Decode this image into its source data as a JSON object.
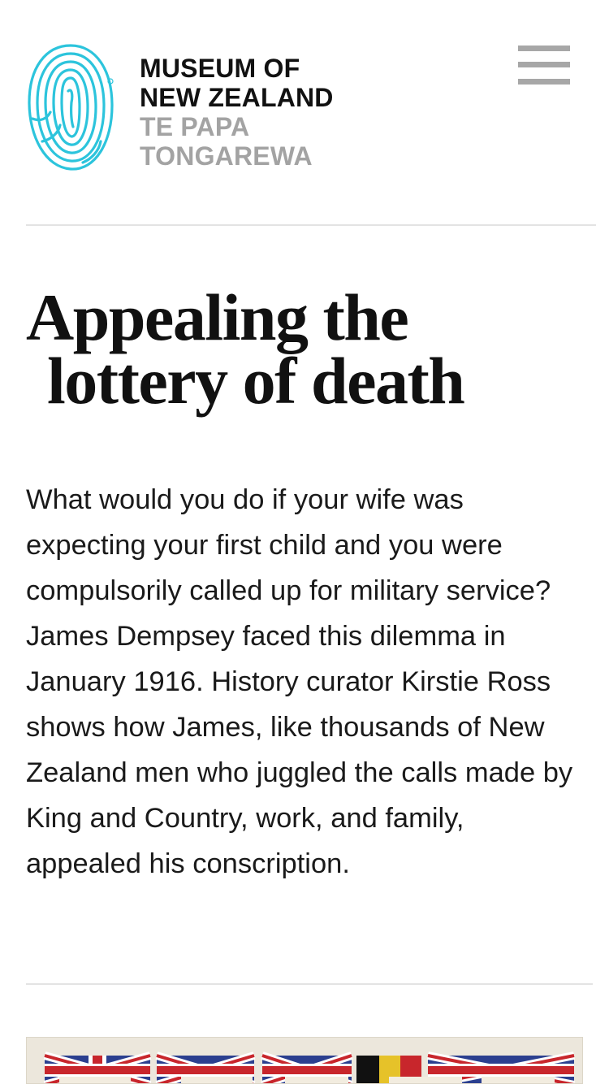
{
  "header": {
    "logo": {
      "icon": "fingerprint-logo-icon",
      "line1": "MUSEUM OF",
      "line2": "NEW ZEALAND",
      "line3": "TE PAPA",
      "line4": "TONGAREWA"
    },
    "menu_icon": "hamburger-menu-icon"
  },
  "article": {
    "title_line1": "Appealing the",
    "title_line2": "lottery of death",
    "intro": "What would you do if your wife was expecting your first child and you were compulsorily called up for military service? James Dempsey faced this dilemma in January 1916. History curator Kirstie Ross shows how James, like thousands of New Zealand men who juggled the calls made by King and Country, work, and family, appealed his conscription."
  },
  "colors": {
    "logo_accent": "#2cc4dc",
    "logo_text_dark": "#111111",
    "logo_text_grey": "#a3a3a3",
    "menu_bars": "#a7a7a7",
    "divider": "#e3e3e3"
  }
}
